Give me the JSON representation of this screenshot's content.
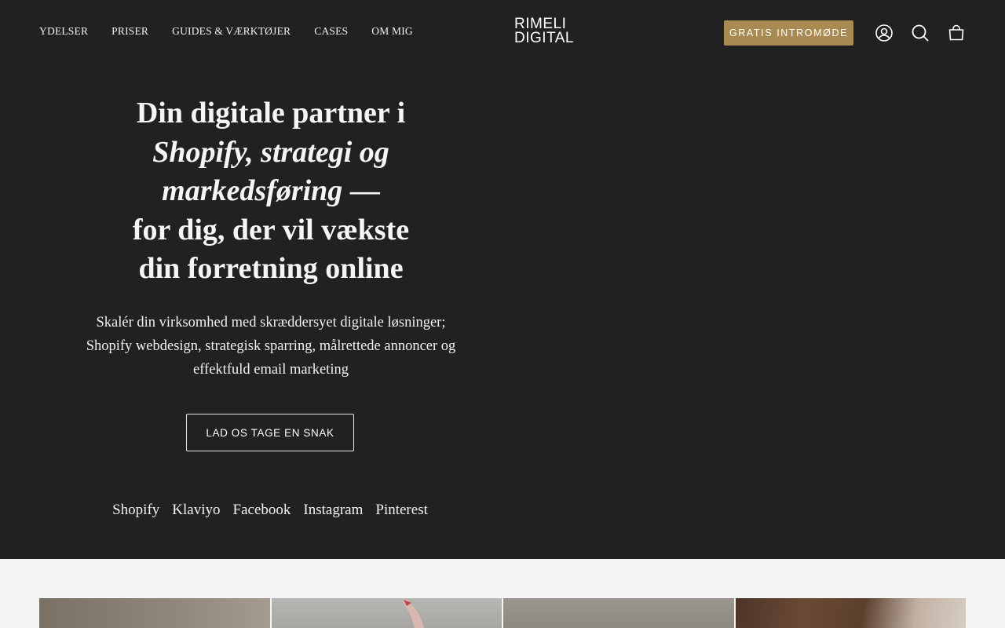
{
  "header": {
    "nav": [
      "YDELSER",
      "PRISER",
      "GUIDES & VÆRKTØJER",
      "CASES",
      "OM MIG"
    ],
    "logo_line1": "RIMELI",
    "logo_line2": "DIGITAL",
    "cta_label": "GRATIS INTROMØDE",
    "icons": [
      "account-icon",
      "search-icon",
      "cart-icon"
    ],
    "cta_color": "#a88a52"
  },
  "hero": {
    "title_line1": "Din digitale partner i",
    "title_em1": "Shopify, strategi og",
    "title_em2": "markedsføring",
    "title_dash": " —",
    "title_line4": "for dig, der vil vækste",
    "title_line5": "din forretning online",
    "subtitle": "Skalér din virksomhed med skræddersyet digitale løsninger; Shopify webdesign, strategisk sparring, målrettede annoncer og effektfuld email marketing",
    "button_label": "LAD OS TAGE EN SNAK",
    "tools": [
      "Shopify",
      "Klaviyo",
      "Facebook",
      "Instagram",
      "Pinterest"
    ]
  },
  "colors": {
    "background": "#212121",
    "lower_background": "#f5f5f5"
  }
}
